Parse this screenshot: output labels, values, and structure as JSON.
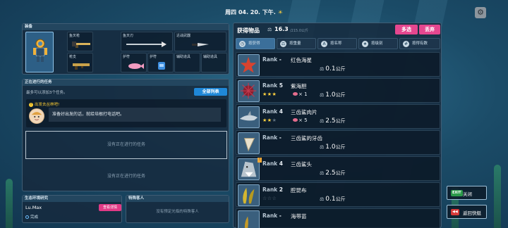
{
  "header": {
    "date": "周四 04. 20. 下午.",
    "time_icon": "sun-icon",
    "settings_icon": "gear-icon"
  },
  "equipment": {
    "title": "装备",
    "slots": [
      {
        "label": "鱼叉枪",
        "icon": "harpoon-gun-icon"
      },
      {
        "label": "鱼叉刃",
        "icon": "harpoon-tip-icon"
      },
      {
        "label": "近战武器",
        "icon": "knife-icon"
      },
      {
        "label": "枪支",
        "icon": "gun-icon"
      },
      {
        "label": "护符",
        "icon": "dolphin-charm-icon"
      },
      {
        "label": "护符",
        "icon": "backpack-charm-icon"
      },
      {
        "label": "辅助道具",
        "icon": ""
      },
      {
        "label": "辅助道具",
        "icon": ""
      }
    ]
  },
  "quests": {
    "title": "正在进行的任务",
    "subtitle": "最多可以添加3个任务。",
    "all_button": "全部列表",
    "notice_title": "出发去丛林吧!",
    "notice_text": "准备好出发的话，就给培根打电话吧。",
    "empty1": "没有正在进行的任务",
    "empty2": "没有正在进行的任务"
  },
  "eco": {
    "title": "生态环境研究",
    "name": "Lu.Max",
    "button": "查看详情",
    "status": "完成"
  },
  "customer": {
    "title": "特殊客人",
    "empty": "没有预定光临的特殊客人"
  },
  "inventory": {
    "title": "获得物品",
    "weight_current": "16.3",
    "weight_max": "/215.0公斤",
    "multi_select": "多选",
    "discard": "丢弃",
    "tabs": [
      "按获得",
      "按重量",
      "按名称",
      "按级别",
      "按得有数"
    ],
    "items": [
      {
        "rank": "-",
        "name": "红色海星",
        "stars": 0,
        "bait": "",
        "weight": "0.1",
        "unit": "公斤",
        "icon": "starfish-icon"
      },
      {
        "rank": "5",
        "name": "紫海胆",
        "stars": 3,
        "bait": "× 1",
        "weight": "1.0",
        "unit": "公斤",
        "icon": "sea-urchin-icon"
      },
      {
        "rank": "4",
        "name": "三齿鲨肉片",
        "stars": 2,
        "bait": "× 5",
        "weight": "2.5",
        "unit": "公斤",
        "icon": "shark-fillet-icon"
      },
      {
        "rank": "-",
        "name": "三齿鲨的牙齿",
        "stars": 0,
        "bait": "",
        "weight": "1.0",
        "unit": "公斤",
        "icon": "shark-tooth-icon"
      },
      {
        "rank": "4",
        "name": "三齿鲨头",
        "stars": 0,
        "bait": "",
        "weight": "2.5",
        "unit": "公斤",
        "icon": "shark-head-icon",
        "new": true
      },
      {
        "rank": "2",
        "name": "腔昆布",
        "stars": 0,
        "bait": "",
        "weight": "0.1",
        "unit": "公斤",
        "icon": "seaweed-icon"
      },
      {
        "rank": "-",
        "name": "海带苗",
        "stars": 0,
        "bait": "",
        "weight": "",
        "unit": "",
        "icon": "kelp-icon"
      }
    ],
    "rank_label": "Rank"
  },
  "side": {
    "exit_badge": "EXIT",
    "exit_label": "关闭",
    "back_badge": "◀◀",
    "back_label": "返回快艇"
  },
  "colors": {
    "accent_pink": "#e5478f",
    "accent_blue": "#1f88d8",
    "star": "#ffd23f"
  }
}
